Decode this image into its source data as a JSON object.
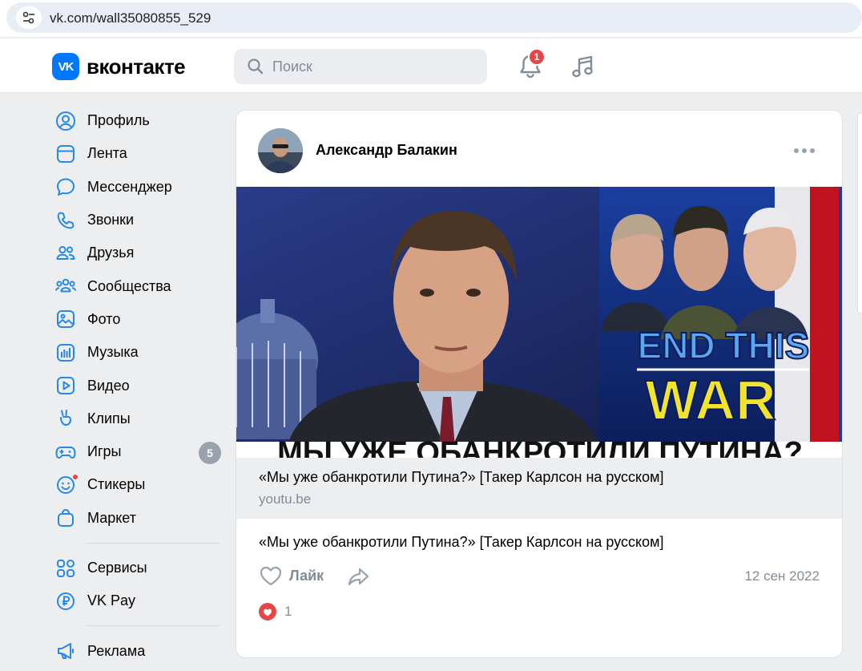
{
  "browser": {
    "url": "vk.com/wall35080855_529"
  },
  "header": {
    "logo_mark": "VK",
    "logo_text": "вконтакте",
    "search_placeholder": "Поиск",
    "notifications_count": "1",
    "accent": "#0077ff"
  },
  "sidebar": {
    "items": [
      {
        "label": "Профиль",
        "icon": "user-circle-icon"
      },
      {
        "label": "Лента",
        "icon": "newsfeed-icon"
      },
      {
        "label": "Мессенджер",
        "icon": "message-icon"
      },
      {
        "label": "Звонки",
        "icon": "phone-icon"
      },
      {
        "label": "Друзья",
        "icon": "friends-icon"
      },
      {
        "label": "Сообщества",
        "icon": "communities-icon"
      },
      {
        "label": "Фото",
        "icon": "photo-icon"
      },
      {
        "label": "Музыка",
        "icon": "music-bars-icon"
      },
      {
        "label": "Видео",
        "icon": "video-icon"
      },
      {
        "label": "Клипы",
        "icon": "clips-icon"
      },
      {
        "label": "Игры",
        "icon": "gamepad-icon",
        "badge": "5"
      },
      {
        "label": "Стикеры",
        "icon": "sticker-icon"
      },
      {
        "label": "Маркет",
        "icon": "market-bag-icon"
      }
    ],
    "extra": [
      {
        "label": "Сервисы",
        "icon": "services-icon"
      },
      {
        "label": "VK Pay",
        "icon": "vkpay-icon"
      }
    ],
    "ads": {
      "label": "Реклама",
      "icon": "megaphone-icon"
    }
  },
  "post": {
    "author": "Александр Балакин",
    "thumbnail": {
      "headline_line1": "END THIS",
      "headline_line2": "WAR",
      "caption": "МЫ УЖЕ ОБАНКРОТИЛИ ПУТИНА?"
    },
    "link": {
      "title": "«Мы уже обанкротили Путина?» [Такер Карлсон на русском]",
      "domain": "youtu.be"
    },
    "text": "«Мы уже обанкротили Путина?» [Такер Карлсон на русском]",
    "like_label": "Лайк",
    "date": "12 сен 2022",
    "reaction_count": "1"
  }
}
